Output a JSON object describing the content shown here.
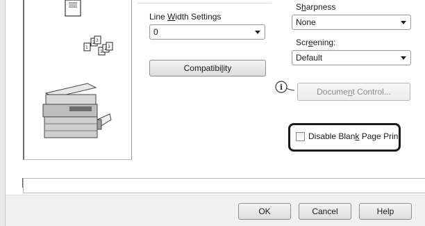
{
  "line_width": {
    "label_pre": "Line ",
    "label_key": "W",
    "label_post": "idth Settings",
    "value": "0"
  },
  "compatibility_button": {
    "label_pre": "Compatibi",
    "label_key": "l",
    "label_post": "ity"
  },
  "sharpness": {
    "label_pre": "S",
    "label_key": "h",
    "label_post": "arpness",
    "value": "None"
  },
  "screening": {
    "label_pre": "Scr",
    "label_key": "e",
    "label_post": "ening:",
    "value": "Default"
  },
  "document_control_button": {
    "label_pre": "Docume",
    "label_key": "n",
    "label_post": "t Control..."
  },
  "disable_blank_page": {
    "label_pre": "Disable Blan",
    "label_key": "k",
    "label_post": " Page Prin",
    "checked": false
  },
  "footer": {
    "ok": "OK",
    "cancel": "Cancel",
    "help": "Help"
  },
  "icons": {
    "info": "info-icon",
    "document": "document-icon",
    "copies": "copies-icon",
    "printer": "printer-icon"
  }
}
